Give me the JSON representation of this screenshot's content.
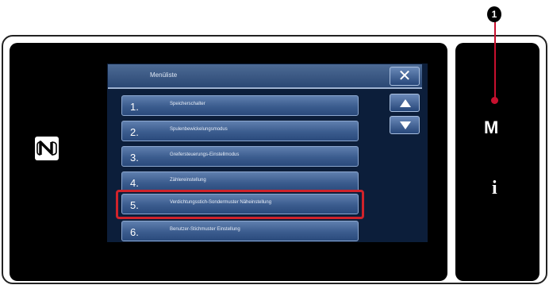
{
  "title": "Menüliste",
  "close_label": "✕",
  "menu_items": [
    {
      "num": "1.",
      "label": "Speicherschalter"
    },
    {
      "num": "2.",
      "label": "Spulenbewickelungsmodus"
    },
    {
      "num": "3.",
      "label": "Greifersteuerungs-Einstellmodus"
    },
    {
      "num": "4.",
      "label": "Zählereinstellung"
    },
    {
      "num": "5.",
      "label": "Verdichtungsstich-Sondermuster Näheinstellung"
    },
    {
      "num": "6.",
      "label": "Benutzer-Stichmuster Einstellung"
    }
  ],
  "side_keys": {
    "m": "M",
    "i": "i"
  },
  "callout": {
    "label": "1"
  },
  "icons": [
    "nfc-icon",
    "scroll-up-icon",
    "scroll-down-icon",
    "close-icon"
  ],
  "colors": {
    "highlight": "#d0232b",
    "screen": "#0c1e3a",
    "button": "#3b5c8e"
  }
}
